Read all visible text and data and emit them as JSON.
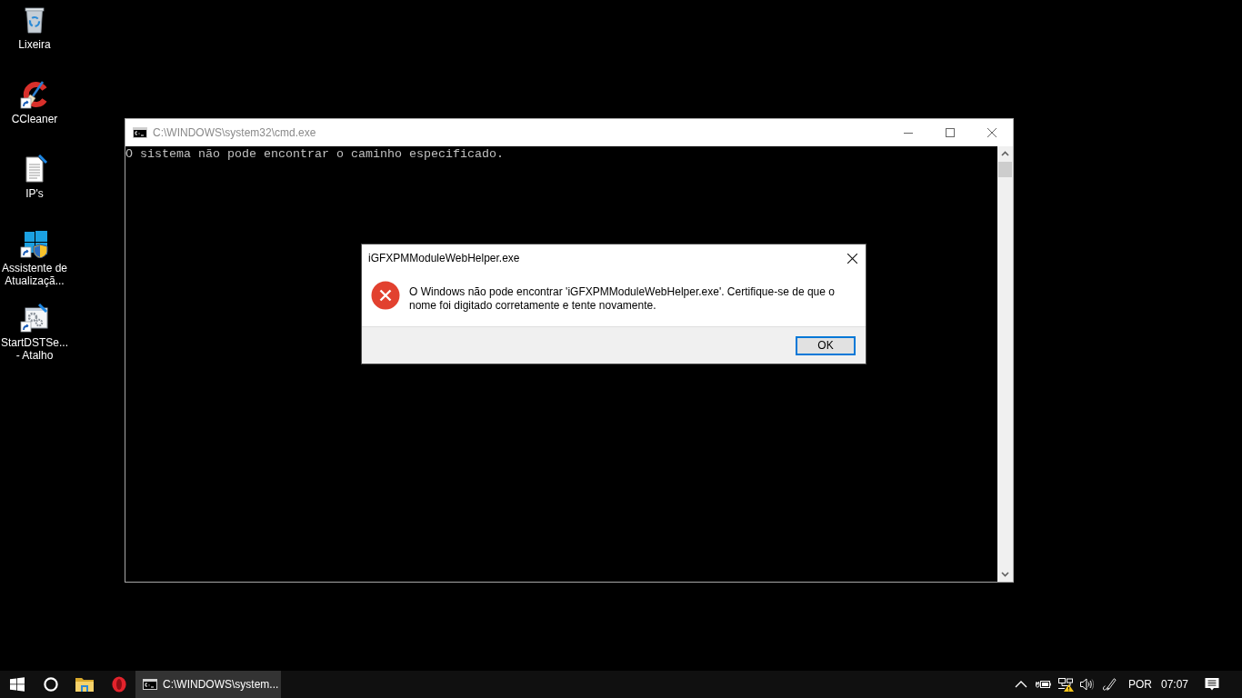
{
  "desktop_icons": [
    {
      "kind": "bin",
      "label": "Lixeira",
      "shortcut": false
    },
    {
      "kind": "cleaner",
      "label": "CCleaner",
      "shortcut": true
    },
    {
      "kind": "document",
      "label": "IP's",
      "shortcut": false
    },
    {
      "kind": "updater",
      "label": "Assistente de Atualizaçã...",
      "shortcut": true
    },
    {
      "kind": "settings",
      "label": "StartDSTSe... - Atalho",
      "shortcut": true
    }
  ],
  "cmd_window": {
    "title": "C:\\WINDOWS\\system32\\cmd.exe",
    "active": false,
    "output": [
      "O sistema não pode encontrar o caminho especificado."
    ]
  },
  "dialog": {
    "title": "iGFXPMModuleWebHelper.exe",
    "kind": "error",
    "message": "O Windows não pode encontrar 'iGFXPMModuleWebHelper.exe'. Certifique-se de que o nome foi digitado corretamente e tente novamente.",
    "buttons": [
      {
        "label": "OK",
        "default": true
      }
    ]
  },
  "taskbar": {
    "windows": [
      {
        "label": "C:\\WINDOWS\\system...",
        "active": true
      }
    ],
    "tray": {
      "language": "POR",
      "time": "07:07"
    }
  }
}
